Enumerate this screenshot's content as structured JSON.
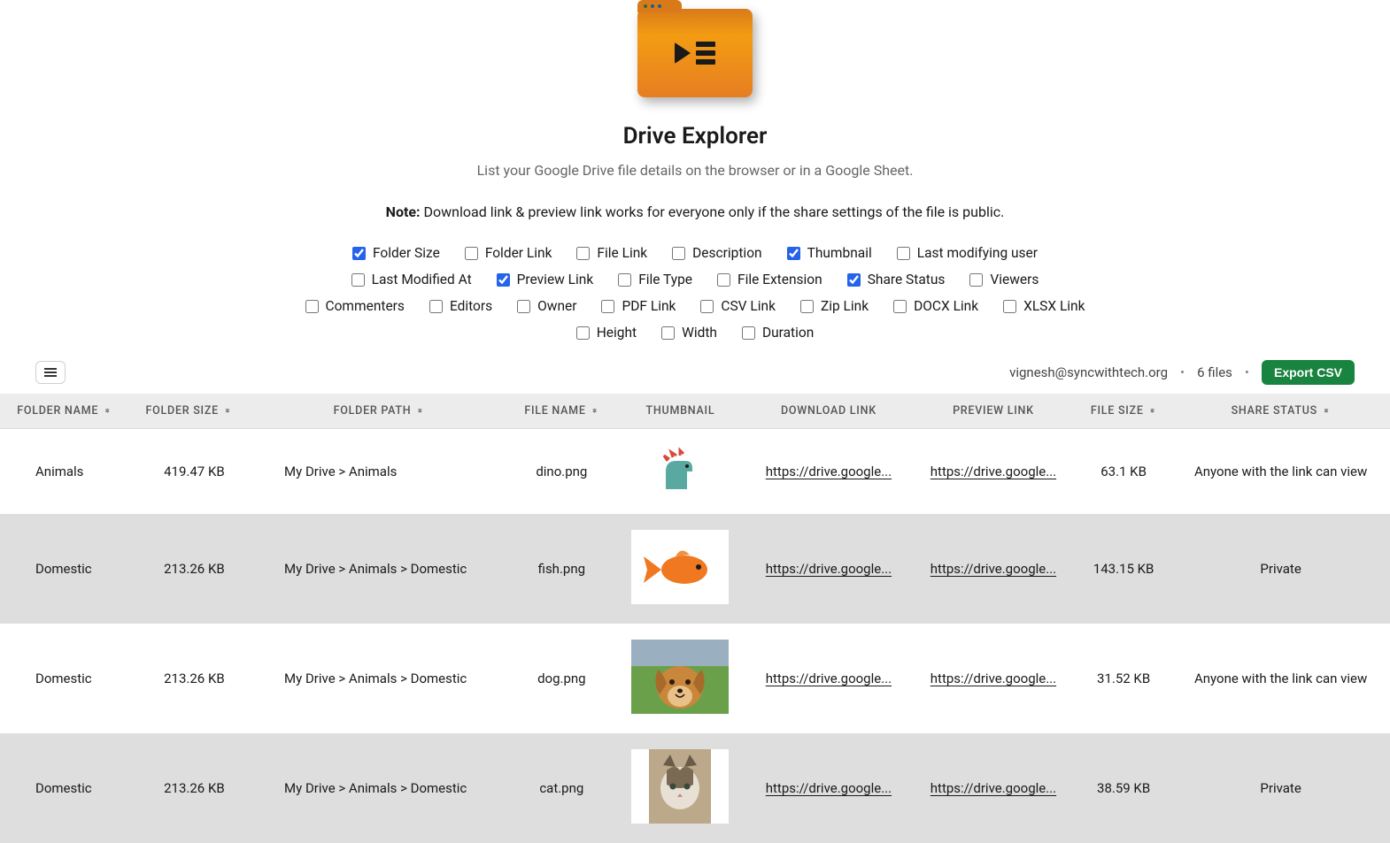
{
  "header": {
    "title": "Drive Explorer",
    "subtitle": "List your Google Drive file details on the browser or in a Google Sheet.",
    "note_label": "Note:",
    "note_text": "Download link & preview link works for everyone only if the share settings of the file is public."
  },
  "checkbox_rows": [
    [
      {
        "label": "Folder Size",
        "checked": true
      },
      {
        "label": "Folder Link",
        "checked": false
      },
      {
        "label": "File Link",
        "checked": false
      },
      {
        "label": "Description",
        "checked": false
      },
      {
        "label": "Thumbnail",
        "checked": true
      },
      {
        "label": "Last modifying user",
        "checked": false
      }
    ],
    [
      {
        "label": "Last Modified At",
        "checked": false
      },
      {
        "label": "Preview Link",
        "checked": true
      },
      {
        "label": "File Type",
        "checked": false
      },
      {
        "label": "File Extension",
        "checked": false
      },
      {
        "label": "Share Status",
        "checked": true
      },
      {
        "label": "Viewers",
        "checked": false
      }
    ],
    [
      {
        "label": "Commenters",
        "checked": false
      },
      {
        "label": "Editors",
        "checked": false
      },
      {
        "label": "Owner",
        "checked": false
      },
      {
        "label": "PDF Link",
        "checked": false
      },
      {
        "label": "CSV Link",
        "checked": false
      },
      {
        "label": "Zip Link",
        "checked": false
      },
      {
        "label": "DOCX Link",
        "checked": false
      },
      {
        "label": "XLSX Link",
        "checked": false
      }
    ],
    [
      {
        "label": "Height",
        "checked": false
      },
      {
        "label": "Width",
        "checked": false
      },
      {
        "label": "Duration",
        "checked": false
      }
    ]
  ],
  "toolbar": {
    "email": "vignesh@syncwithtech.org",
    "file_count": "6 files",
    "export_label": "Export CSV"
  },
  "table": {
    "columns": [
      {
        "label": "FOLDER NAME",
        "sortable": true
      },
      {
        "label": "FOLDER SIZE",
        "sortable": true
      },
      {
        "label": "FOLDER PATH",
        "sortable": true
      },
      {
        "label": "FILE NAME",
        "sortable": true
      },
      {
        "label": "THUMBNAIL",
        "sortable": false
      },
      {
        "label": "DOWNLOAD LINK",
        "sortable": false
      },
      {
        "label": "PREVIEW LINK",
        "sortable": false
      },
      {
        "label": "FILE SIZE",
        "sortable": true
      },
      {
        "label": "SHARE STATUS",
        "sortable": true
      }
    ],
    "rows": [
      {
        "folder_name": "Animals",
        "folder_size": "419.47 KB",
        "folder_path": "My Drive > Animals",
        "file_name": "dino.png",
        "thumb": "dino",
        "download_link": "https://drive.google...",
        "preview_link": "https://drive.google...",
        "file_size": "63.1 KB",
        "share_status": "Anyone with the link can view"
      },
      {
        "folder_name": "Domestic",
        "folder_size": "213.26 KB",
        "folder_path": "My Drive > Animals > Domestic",
        "file_name": "fish.png",
        "thumb": "fish",
        "download_link": "https://drive.google...",
        "preview_link": "https://drive.google...",
        "file_size": "143.15 KB",
        "share_status": "Private"
      },
      {
        "folder_name": "Domestic",
        "folder_size": "213.26 KB",
        "folder_path": "My Drive > Animals > Domestic",
        "file_name": "dog.png",
        "thumb": "dog",
        "download_link": "https://drive.google...",
        "preview_link": "https://drive.google...",
        "file_size": "31.52 KB",
        "share_status": "Anyone with the link can view"
      },
      {
        "folder_name": "Domestic",
        "folder_size": "213.26 KB",
        "folder_path": "My Drive > Animals > Domestic",
        "file_name": "cat.png",
        "thumb": "cat",
        "download_link": "https://drive.google...",
        "preview_link": "https://drive.google...",
        "file_size": "38.59 KB",
        "share_status": "Private"
      }
    ]
  }
}
